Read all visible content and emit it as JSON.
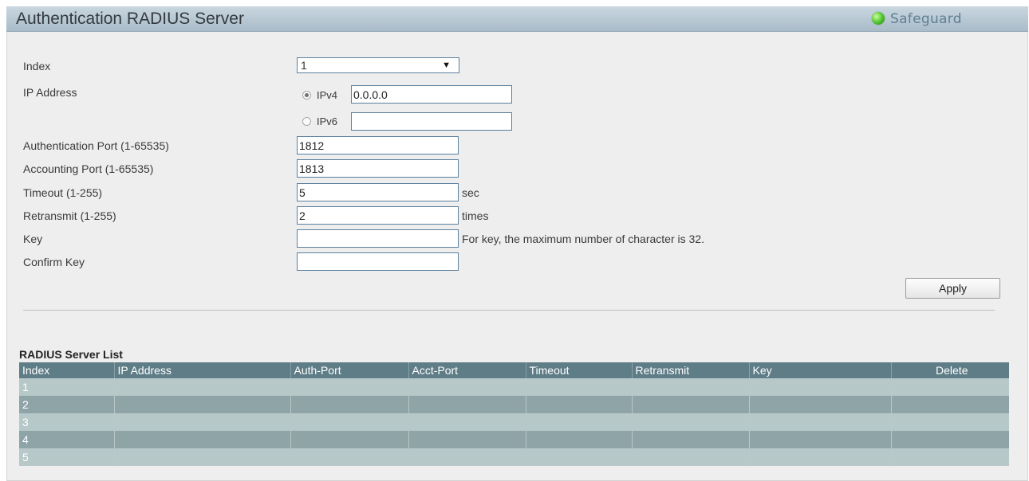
{
  "header": {
    "title": "Authentication RADIUS Server",
    "safeguard_label": "Safeguard",
    "safeguard_indicator_color": "#4cc12a",
    "safeguard_icon": "status-led-icon"
  },
  "form": {
    "index": {
      "label": "Index",
      "value": "1",
      "caret": "▼"
    },
    "ip_address": {
      "label": "IP Address",
      "ipv4": {
        "label": "IPv4",
        "value": "0.0.0.0",
        "selected": true
      },
      "ipv6": {
        "label": "IPv6",
        "value": "",
        "selected": false
      }
    },
    "auth_port": {
      "label": "Authentication Port (1-65535)",
      "value": "1812"
    },
    "acct_port": {
      "label": "Accounting Port (1-65535)",
      "value": "1813"
    },
    "timeout": {
      "label": "Timeout (1-255)",
      "value": "5",
      "unit": "sec"
    },
    "retransmit": {
      "label": "Retransmit (1-255)",
      "value": "2",
      "unit": "times"
    },
    "key": {
      "label": "Key",
      "value": "",
      "hint": "For key, the maximum number of character is 32."
    },
    "confirm_key": {
      "label": "Confirm Key",
      "value": ""
    },
    "apply_label": "Apply"
  },
  "list": {
    "title": "RADIUS Server List",
    "columns": [
      "Index",
      "IP Address",
      "Auth-Port",
      "Acct-Port",
      "Timeout",
      "Retransmit",
      "Key",
      "Delete"
    ],
    "rows": [
      {
        "index": "1",
        "ip": "",
        "auth_port": "",
        "acct_port": "",
        "timeout": "",
        "retransmit": "",
        "key": "",
        "delete": ""
      },
      {
        "index": "2",
        "ip": "",
        "auth_port": "",
        "acct_port": "",
        "timeout": "",
        "retransmit": "",
        "key": "",
        "delete": ""
      },
      {
        "index": "3",
        "ip": "",
        "auth_port": "",
        "acct_port": "",
        "timeout": "",
        "retransmit": "",
        "key": "",
        "delete": ""
      },
      {
        "index": "4",
        "ip": "",
        "auth_port": "",
        "acct_port": "",
        "timeout": "",
        "retransmit": "",
        "key": "",
        "delete": ""
      },
      {
        "index": "5",
        "ip": "",
        "auth_port": "",
        "acct_port": "",
        "timeout": "",
        "retransmit": "",
        "key": "",
        "delete": ""
      }
    ]
  },
  "colors": {
    "title_bar": "#b9cad5",
    "table_header": "#5f7d87",
    "row_light": "#b7c8c9",
    "row_dark": "#8fa4a7"
  }
}
